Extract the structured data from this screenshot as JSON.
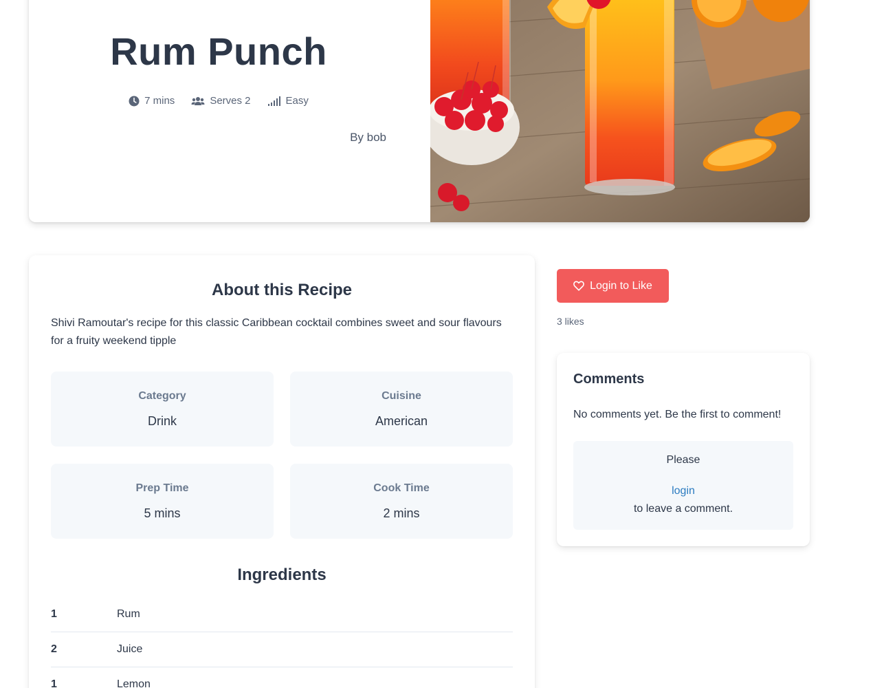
{
  "recipe": {
    "title": "Rum Punch",
    "meta": {
      "time": "7 mins",
      "serves": "Serves 2",
      "difficulty": "Easy"
    },
    "author": "By bob"
  },
  "about": {
    "heading": "About this Recipe",
    "description": "Shivi Ramoutar's recipe for this classic Caribbean cocktail combines sweet and sour flavours for a fruity weekend tipple",
    "category": {
      "label": "Category",
      "value": "Drink"
    },
    "cuisine": {
      "label": "Cuisine",
      "value": "American"
    },
    "prep_time": {
      "label": "Prep Time",
      "value": "5 mins"
    },
    "cook_time": {
      "label": "Cook Time",
      "value": "2 mins"
    }
  },
  "ingredients": {
    "heading": "Ingredients",
    "items": [
      {
        "qty": "1",
        "name": "Rum"
      },
      {
        "qty": "2",
        "name": "Juice"
      },
      {
        "qty": "1",
        "name": "Lemon"
      }
    ]
  },
  "likes": {
    "button_label": "Login to Like",
    "count_text": "3 likes"
  },
  "comments": {
    "heading": "Comments",
    "empty_text": "No comments yet. Be the first to comment!",
    "prompt_before": "Please",
    "login_link": "login",
    "prompt_after": "to leave a comment."
  },
  "colors": {
    "heading": "#2d3748",
    "muted": "#6b7a8f",
    "like_button": "#f25b5b",
    "link": "#2b7bc0",
    "panel_bg": "#f5f8fb"
  },
  "icons": {
    "time": "clock-icon",
    "serves": "users-icon",
    "difficulty": "signal-bars-icon",
    "like": "heart-icon"
  }
}
